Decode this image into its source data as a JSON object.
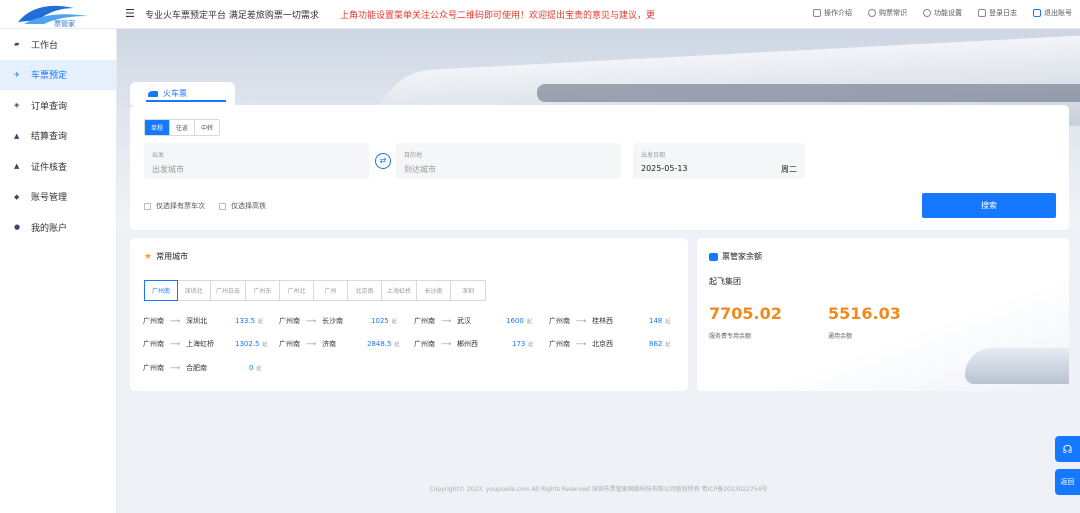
{
  "header": {
    "logo_text": "票管家",
    "slogan": "专业火车票预定平台 满足差旅购票一切需求",
    "notice": "上角功能设置菜单关注公众号二维码即可使用！欢迎提出宝贵的意见与建议，更",
    "links": [
      {
        "label": "操作介绍",
        "icon": "book-icon"
      },
      {
        "label": "购票常识",
        "icon": "question-icon"
      },
      {
        "label": "功能设置",
        "icon": "gear-icon"
      },
      {
        "label": "登录日志",
        "icon": "log-icon"
      },
      {
        "label": "退出账号",
        "icon": "logout-icon"
      }
    ]
  },
  "sidebar": {
    "items": [
      {
        "label": "工作台",
        "icon": "home-icon"
      },
      {
        "label": "车票预定",
        "icon": "ticket-icon",
        "active": true
      },
      {
        "label": "订单查询",
        "icon": "order-icon"
      },
      {
        "label": "结算查询",
        "icon": "settle-icon"
      },
      {
        "label": "证件核查",
        "icon": "id-icon"
      },
      {
        "label": "账号管理",
        "icon": "account-icon"
      },
      {
        "label": "我的账户",
        "icon": "user-icon"
      }
    ]
  },
  "search": {
    "tab_label": "火车票",
    "trip_types": [
      "单程",
      "往返",
      "中转"
    ],
    "from": {
      "label": "出发",
      "placeholder": "出发城市"
    },
    "to": {
      "label": "目的地",
      "placeholder": "到达城市"
    },
    "date": {
      "label": "出发日期",
      "value": "2025-05-13",
      "weekday": "周二"
    },
    "checks": [
      "仅选择有票车次",
      "仅选择高铁"
    ],
    "button": "搜索"
  },
  "cities": {
    "title": "常用城市",
    "tabs": [
      "广州南",
      "深圳北",
      "广州白云",
      "广州东",
      "广州北",
      "广州",
      "北京南",
      "上海虹桥",
      "长沙南",
      "深圳"
    ],
    "routes": [
      {
        "from": "广州南",
        "to": "深圳北",
        "price": "133.5",
        "unit": "起"
      },
      {
        "from": "广州南",
        "to": "长沙南",
        "price": "1025",
        "unit": "起"
      },
      {
        "from": "广州南",
        "to": "武汉",
        "price": "1600",
        "unit": "起"
      },
      {
        "from": "广州南",
        "to": "桂林西",
        "price": "148",
        "unit": "起"
      },
      {
        "from": "广州南",
        "to": "上海虹桥",
        "price": "1302.5",
        "unit": "起"
      },
      {
        "from": "广州南",
        "to": "济南",
        "price": "2848.5",
        "unit": "起"
      },
      {
        "from": "广州南",
        "to": "郴州西",
        "price": "173",
        "unit": "起"
      },
      {
        "from": "广州南",
        "to": "北京西",
        "price": "862",
        "unit": "起"
      },
      {
        "from": "广州南",
        "to": "合肥南",
        "price": "0",
        "unit": "起"
      }
    ]
  },
  "balance": {
    "title": "票管家余额",
    "company": "起飞集团",
    "service_fee_amount": "7705.02",
    "service_fee_label": "服务费专用余额",
    "general_amount": "5516.03",
    "general_label": "通用余额"
  },
  "footer": "Copyright© 2023. youpiaole.com All Rights Reserved 深圳市票管家网络科技有限公司版权所有 粤ICP备2023022754号",
  "float": {
    "back_label": "返回"
  },
  "colors": {
    "primary": "#1677ff",
    "amount": "#f08a1c",
    "notice": "#e03b2f"
  }
}
